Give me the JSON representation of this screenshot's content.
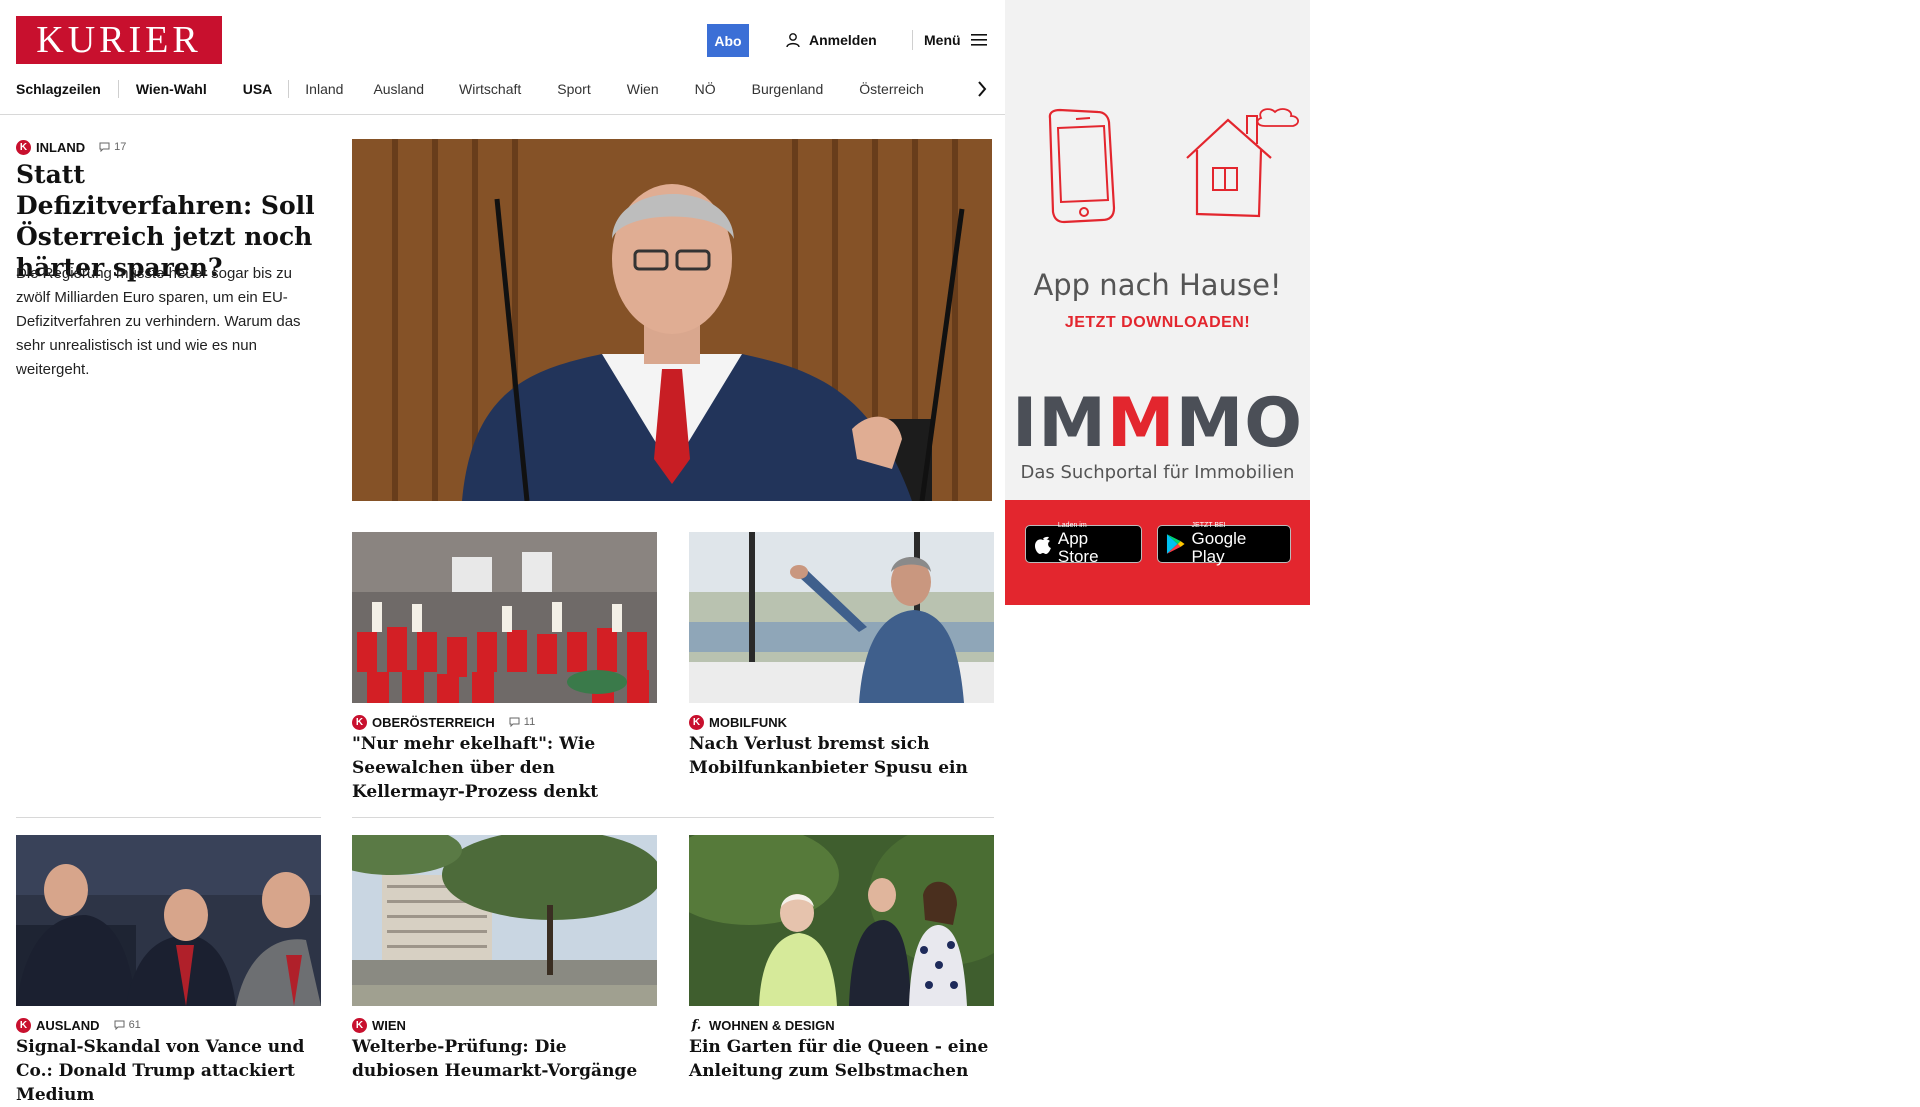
{
  "header": {
    "logo_text": "KURIER",
    "abo_label": "Abo",
    "login_label": "Anmelden",
    "menu_label": "Menü",
    "nav": [
      "Schlagzeilen",
      "Wien-Wahl",
      "USA",
      "Inland",
      "Ausland",
      "Wirtschaft",
      "Sport",
      "Wien",
      "NÖ",
      "Burgenland",
      "Österreich"
    ]
  },
  "lead": {
    "category": "INLAND",
    "comments": "17",
    "title": "Statt Defizitverfahren: Soll Österreich jetzt noch härter sparen?",
    "teaser": "Die Regierung müsste heuer sogar bis zu zwölf Milliarden Euro sparen, um ein EU-Defizitverfahren zu verhindern. Warum das sehr unrealistisch ist und wie es nun weitergeht."
  },
  "articles": [
    {
      "category": "OBERÖSTERREICH",
      "comments": "11",
      "title": "\"Nur mehr ekelhaft\": Wie Seewalchen über den Kellermayr-Prozess denkt",
      "icon": "kurier-k-icon"
    },
    {
      "category": "MOBILFUNK",
      "comments": "",
      "title": "Nach Verlust bremst sich Mobilfunkanbieter Spusu ein",
      "icon": "kurier-k-icon"
    },
    {
      "category": "AUSLAND",
      "comments": "61",
      "title": "Signal-Skandal von Vance und Co.: Donald Trump attackiert Medium",
      "icon": "kurier-k-icon"
    },
    {
      "category": "WIEN",
      "comments": "",
      "title": "Welterbe-Prüfung: Die dubiosen Heumarkt-Vorgänge",
      "icon": "kurier-k-icon"
    },
    {
      "category": "WOHNEN & DESIGN",
      "comments": "",
      "title": "Ein Garten für die Queen - eine Anleitung zum Selbstmachen",
      "icon": "freizeit-f-icon"
    }
  ],
  "ad": {
    "headline": "App nach Hause!",
    "subline": "JETZT DOWNLOADEN!",
    "brand": "IMMMO",
    "brand_tagline": "Das Suchportal für Immobilien",
    "appstore_small": "Laden im",
    "appstore_big": "App Store",
    "googleplay_small": "JETZT BEI",
    "googleplay_big": "Google Play"
  },
  "colors": {
    "brand_red": "#c8102e",
    "abo_blue": "#3b6fd6",
    "ad_red": "#e3262e",
    "ad_bg": "#f2f2f2"
  }
}
